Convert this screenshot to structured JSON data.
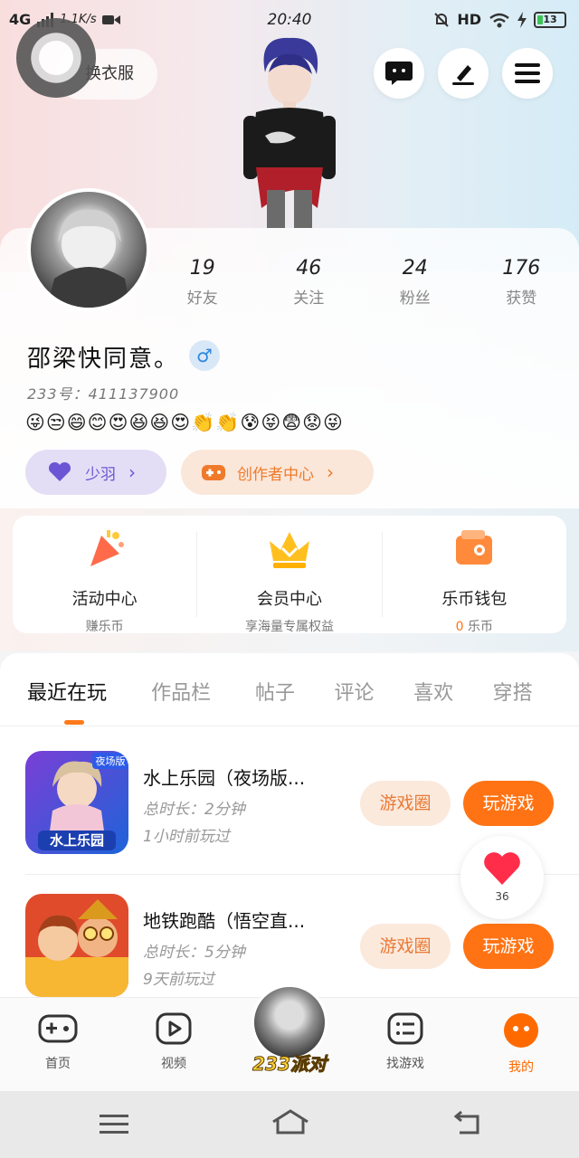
{
  "status_bar": {
    "network": "4G",
    "speed": "1.1K/s",
    "time": "20:40",
    "hd": "HD",
    "battery": "13"
  },
  "header": {
    "outfit_button": "换衣服"
  },
  "profile": {
    "stats": [
      {
        "value": "19",
        "label": "好友"
      },
      {
        "value": "46",
        "label": "关注"
      },
      {
        "value": "24",
        "label": "粉丝"
      },
      {
        "value": "176",
        "label": "获赞"
      }
    ],
    "name": "邵梁快同意。",
    "gender_symbol": "♂",
    "uid": "233号：411137900",
    "emojis": "😜😒😄😊😍😆😆😍👏👏😰😝😨😟😜",
    "badge_label": "少羽",
    "creator_label": "创作者中心"
  },
  "quick_links": [
    {
      "title": "活动中心",
      "subtitle": "赚乐币"
    },
    {
      "title": "会员中心",
      "subtitle": "享海量专属权益"
    },
    {
      "title": "乐币钱包",
      "subtitle_value": "0",
      "subtitle": "乐币"
    }
  ],
  "tabs": [
    "最近在玩",
    "作品栏",
    "帖子",
    "评论",
    "喜欢",
    "穿搭"
  ],
  "games": [
    {
      "title": "水上乐园（夜场版...",
      "duration": "总时长：2分钟",
      "last_played": "1小时前玩过",
      "thumb_label": "水上乐园",
      "thumb_tag": "夜场版",
      "circle_button": "游戏圈",
      "play_button": "玩游戏"
    },
    {
      "title": "地铁跑酷（悟空直...",
      "duration": "总时长：5分钟",
      "last_played": "9天前玩过",
      "circle_button": "游戏圈",
      "play_button": "玩游戏"
    }
  ],
  "like_count": "36",
  "bottom_nav": [
    {
      "label": "首页",
      "icon": "gamepad-icon"
    },
    {
      "label": "视频",
      "icon": "video-play-icon"
    },
    {
      "label": "233派对",
      "icon": "party-avatar"
    },
    {
      "label": "找游戏",
      "icon": "list-icon"
    },
    {
      "label": "我的",
      "icon": "profile-dots-icon"
    }
  ],
  "colors": {
    "accent": "#ff7314",
    "purple": "#6c55d4",
    "male_blue": "#2b86e0"
  }
}
